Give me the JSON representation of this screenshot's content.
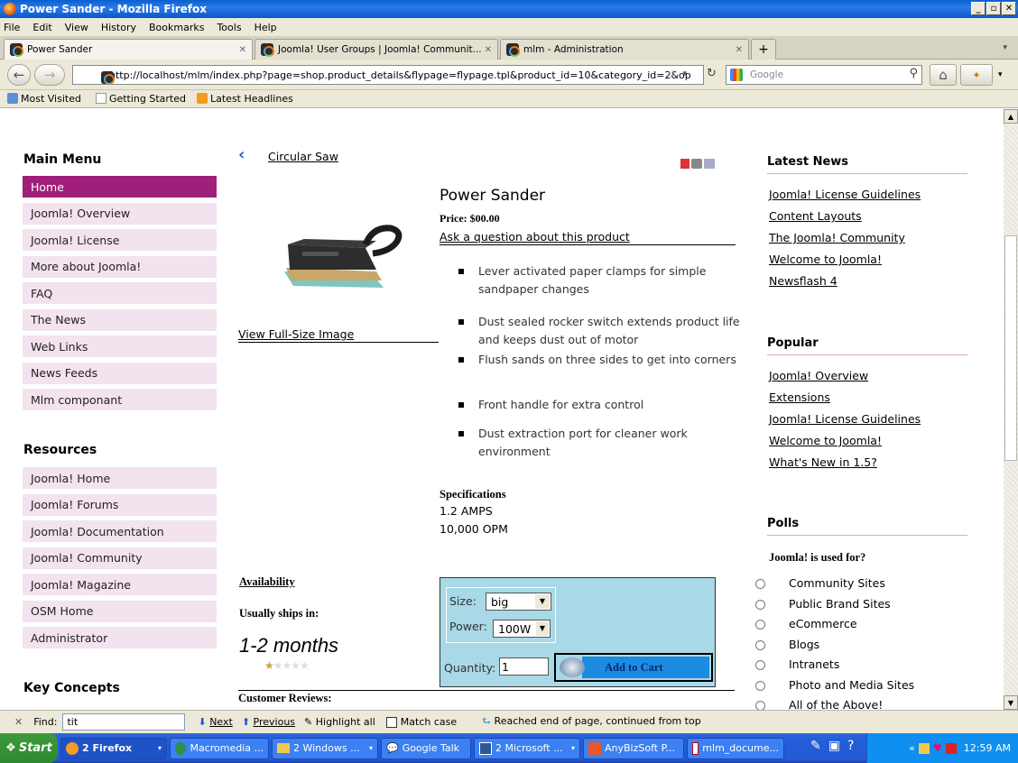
{
  "window": {
    "title": "Power Sander - Mozilla Firefox"
  },
  "menubar": [
    "File",
    "Edit",
    "View",
    "History",
    "Bookmarks",
    "Tools",
    "Help"
  ],
  "tabs": [
    {
      "label": "Power Sander",
      "active": true
    },
    {
      "label": "Joomla! User Groups | Joomla! Communit...",
      "active": false
    },
    {
      "label": "mlm - Administration",
      "active": false
    }
  ],
  "tab_new_label": "+",
  "address": {
    "url": "http://localhost/mlm/index.php?page=shop.product_details&flypage=flypage.tpl&product_id=10&category_id=2&op",
    "search_placeholder": "Google"
  },
  "bookmarks": [
    "Most Visited",
    "Getting Started",
    "Latest Headlines"
  ],
  "main_menu": {
    "title": "Main Menu",
    "items": [
      "Home",
      "Joomla! Overview",
      "Joomla! License",
      "More about Joomla!",
      "FAQ",
      "The News",
      "Web Links",
      "News Feeds",
      "Mlm componant"
    ]
  },
  "resources": {
    "title": "Resources",
    "items": [
      "Joomla! Home",
      "Joomla! Forums",
      "Joomla! Documentation",
      "Joomla! Community",
      "Joomla! Magazine",
      "OSM Home",
      "Administrator"
    ]
  },
  "key_concepts": {
    "title": "Key Concepts"
  },
  "product": {
    "back_link": "Circular Saw",
    "name": "Power Sander",
    "price": "Price: $00.00",
    "ask_link": "Ask a question about this product",
    "view_full": "View Full-Size Image",
    "features": [
      "Lever activated paper clamps for simple sandpaper changes",
      "Dust sealed rocker switch extends product life and keeps dust out of motor",
      "Flush sands on three sides to get into corners",
      "Front handle for extra control",
      "Dust extraction port for cleaner work environment"
    ],
    "spec_title": "Specifications",
    "specs": [
      "1.2 AMPS",
      "10,000 OPM"
    ],
    "availability_title": "Availability",
    "ships_label": "Usually ships in:",
    "ships_value": "1-2 months",
    "rating": 1,
    "rating_max": 5,
    "reviews_title": "Customer Reviews:",
    "size_label": "Size:",
    "size_value": "big",
    "power_label": "Power:",
    "power_value": "100W",
    "qty_label": "Quantity:",
    "qty_value": "1",
    "add_to_cart": "Add to Cart"
  },
  "latest_news": {
    "title": "Latest News",
    "items": [
      "Joomla! License Guidelines",
      "Content Layouts",
      "The Joomla! Community",
      "Welcome to Joomla!",
      "Newsflash 4"
    ]
  },
  "popular": {
    "title": "Popular",
    "items": [
      "Joomla! Overview",
      "Extensions",
      "Joomla! License Guidelines",
      "Welcome to Joomla!",
      "What's New in 1.5?"
    ]
  },
  "polls": {
    "title": "Polls",
    "question": "Joomla! is used for?",
    "options": [
      "Community Sites",
      "Public Brand Sites",
      "eCommerce",
      "Blogs",
      "Intranets",
      "Photo and Media Sites",
      "All of the Above!"
    ]
  },
  "findbar": {
    "label": "Find:",
    "value": "tit",
    "next": "Next",
    "previous": "Previous",
    "highlight": "Highlight all",
    "match_case": "Match case",
    "status": "Reached end of page, continued from top"
  },
  "taskbar": {
    "start": "Start",
    "tasks": [
      "2 Firefox",
      "Macromedia ...",
      "2 Windows ...",
      "Google Talk",
      "2 Microsoft ...",
      "AnyBizSoft P...",
      "mlm_docume..."
    ],
    "clock": "12:59 AM"
  }
}
